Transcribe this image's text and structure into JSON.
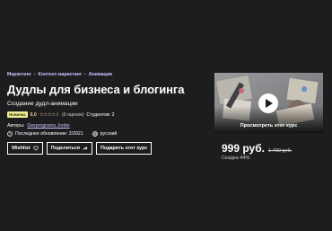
{
  "breadcrumb": {
    "items": [
      "Маркетинг",
      "Контент-маркетинг",
      "Анимация"
    ]
  },
  "course": {
    "title": "Дудлы для бизнеса и блогинга",
    "subtitle": "Создание дудл-анимации",
    "badge": "Новинка",
    "rating": "0,0",
    "ratings_count": "(0 оценок)",
    "students": "Студентов: 2",
    "authors_label": "Авторы:",
    "author": "Deeprograma Joobe",
    "last_updated": "Последнее обновление: 2/2021",
    "language": "русский"
  },
  "actions": {
    "wishlist": "Wishlist",
    "share": "Поделиться",
    "gift": "Подарить этот курс"
  },
  "sidebar": {
    "preview_label": "Просмотреть этот курс",
    "price": "999 руб.",
    "original_price": "1 790 руб.",
    "discount": "Скидка 44%"
  },
  "colors": {
    "background": "#1c1d1f",
    "link": "#cec0fc",
    "rating": "#f3ca8c",
    "badge_bg": "#eceb98"
  }
}
